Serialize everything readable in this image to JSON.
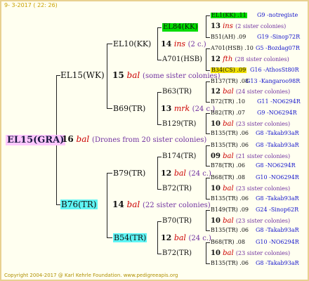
{
  "header": "9-  3-2017  ( 22: 26)",
  "footer": "Copyright 2004-2017 @ Karl Kehrle Foundation.   www.pedigreeapis.org",
  "root": {
    "id": "EL15(GRA)",
    "count": "16",
    "tag": "bal",
    "note": "(Drones from 20 sister colonies)"
  },
  "p": {
    "id": "EL15(WK)",
    "count": "15",
    "tag": "bal",
    "note": "(some sister colonies)"
  },
  "m": {
    "id": "B76(TR)",
    "count": "14",
    "tag": "bal",
    "note": "(22 sister colonies)"
  },
  "pp": {
    "id": "EL10(KK)",
    "count": "14",
    "tag": "ins",
    "note": "(2 c.)"
  },
  "pm": {
    "id": "B69(TR)",
    "count": "13",
    "tag": "mrk",
    "note": "(24 c.)"
  },
  "mp": {
    "id": "B79(TR)",
    "count": "12",
    "tag": "bal",
    "note": "(24 c.)"
  },
  "mm": {
    "id": "B54(TR)",
    "count": "12",
    "tag": "bal",
    "note": "(24 c.)"
  },
  "ppp": {
    "id": "EL84(KK)",
    "count": "13",
    "tag": "ins",
    "note": "(2 sister colonies)"
  },
  "ppm": {
    "id": "A701(HSB)",
    "count": "12",
    "tag": "fth",
    "note": "(28 sister colonies)"
  },
  "pmp": {
    "id": "B63(TR)",
    "count": "12",
    "tag": "bal",
    "note": "(24 sister colonies)"
  },
  "pmm": {
    "id": "B129(TR)",
    "count": "10",
    "tag": "bal",
    "note": "(23 sister colonies)"
  },
  "mpp": {
    "id": "B174(TR)",
    "count": "09",
    "tag": "bal",
    "note": "(21 sister colonies)"
  },
  "mpm": {
    "id": "B72(TR)",
    "count": "10",
    "tag": "bal",
    "note": "(23 sister colonies)"
  },
  "mmp": {
    "id": "B70(TR)",
    "count": "10",
    "tag": "bal",
    "note": "(23 sister colonies)"
  },
  "mmm": {
    "id": "B72(TR)",
    "count": "10",
    "tag": "bal",
    "note": "(23 sister colonies)"
  },
  "g4": [
    {
      "id": "EL1(KK)",
      "year": ".11",
      "code": "G9 -notregiste"
    },
    {
      "id": "B51(AH)",
      "year": ".09",
      "code": "G19 -Sinop72R"
    },
    {
      "id": "A701(HSB)",
      "year": ".10",
      "code": "G5 -Bozdag07R"
    },
    {
      "id": "B34(CS)",
      "year": ".09",
      "code": "G16 -AthosSt80R"
    },
    {
      "id": "B137(TR)",
      "year": ".08",
      "code": "G13 -Kangaroo98R"
    },
    {
      "id": "B72(TR)",
      "year": ".10",
      "code": "G11 -NO6294R"
    },
    {
      "id": "B82(TR)",
      "year": ".07",
      "code": "G9 -NO6294R"
    },
    {
      "id": "B135(TR)",
      "year": ".06",
      "code": "G8 -Takab93aR"
    },
    {
      "id": "B135(TR)",
      "year": ".06",
      "code": "G8 -Takab93aR"
    },
    {
      "id": "B78(TR)",
      "year": ".06",
      "code": "G8 -NO6294R"
    },
    {
      "id": "B68(TR)",
      "year": ".08",
      "code": "G10 -NO6294R"
    },
    {
      "id": "B135(TR)",
      "year": ".06",
      "code": "G8 -Takab93aR"
    },
    {
      "id": "B149(TR)",
      "year": ".09",
      "code": "G24 -Sinop62R"
    },
    {
      "id": "B135(TR)",
      "year": ".06",
      "code": "G8 -Takab93aR"
    },
    {
      "id": "B68(TR)",
      "year": ".08",
      "code": "G10 -NO6294R"
    },
    {
      "id": "B135(TR)",
      "year": ".06",
      "code": "G8 -Takab93aR"
    }
  ],
  "colors": {
    "frame": "#e8d090",
    "root_bg": "#ffc8ff",
    "cyan": "#5ef5f5",
    "green": "#00dd00",
    "yellow": "#f0e000",
    "tag_red": "#cc0000",
    "info_blue": "#1515cc",
    "note_purple": "#7030a0"
  }
}
